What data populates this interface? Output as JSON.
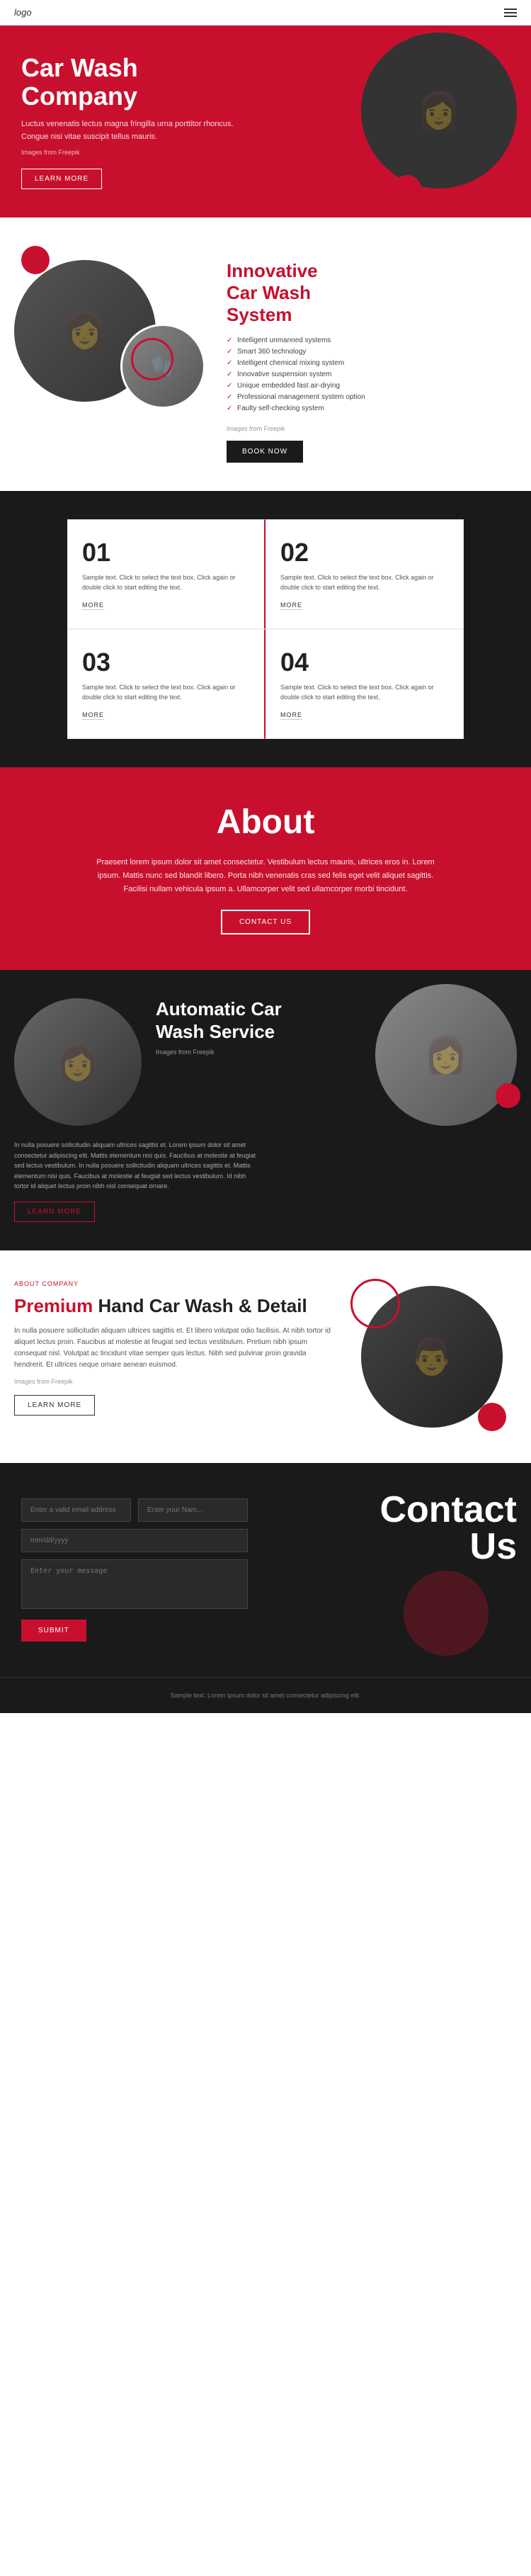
{
  "header": {
    "logo": "logo",
    "menu_icon": "≡"
  },
  "hero": {
    "title_line1": "Car Wash",
    "title_line2": "Company",
    "body": "Luctus venenatis lectus magna fringilla urna porttitor rhoncus. Congue nisi vitae suscipit tellus mauris.",
    "img_credit": "Images from Freepik",
    "learn_more": "LEARN MORE"
  },
  "innovative": {
    "title_part1": "Innovative",
    "title_part2": "Car Wash",
    "title_part3": "System",
    "img_credit": "Images from Freepik",
    "features": [
      "Intelligent unmanned systems",
      "Smart 360 technology",
      "Intelligent chemical mixing system",
      "Innovative suspension system",
      "Unique embedded fast air-drying",
      "Professional management system option",
      "Faulty self-checking system"
    ],
    "book_now": "BOOK NOW"
  },
  "numbers": {
    "items": [
      {
        "number": "01",
        "text": "Sample text. Click to select the text box. Click again or double click to start editing the text.",
        "more": "MORE"
      },
      {
        "number": "02",
        "text": "Sample text. Click to select the text box. Click again or double click to start editing the text.",
        "more": "MORE"
      },
      {
        "number": "03",
        "text": "Sample text. Click to select the text box. Click again or double click to start editing the text.",
        "more": "MORE"
      },
      {
        "number": "04",
        "text": "Sample text. Click to select the text box. Click again or double click to start editing the text.",
        "more": "MORE"
      }
    ]
  },
  "about": {
    "title": "About",
    "body": "Praesent lorem ipsum dolor sit amet consectetur. Vestibulum lectus mauris, ultrices eros in. Lorem ipsum. Mattis nunc sed blandit libero. Porta nibh venenatis cras sed felis eget velit aliquet sagittis. Facilisi nullam vehicula ipsum a. Ullamcorper velit sed ullamcorper morbi tincidunt.",
    "contact_us": "CONTACT US"
  },
  "auto_wash": {
    "title_line1": "Automatic Car",
    "title_line2": "Wash Service",
    "img_credit": "Images from Freepik",
    "body": "In nulla posuere sollicitudin aliquam ultrices sagittis et. Lorem ipsum dolor sit amet consectetur adipiscing elit. Mattis elementum nisi quis. Faucibus at molestie at feugiat sed lectus vestibulum. In nulla posuere sollicitudin aliquam ultrices sagittis et. Mattis elementum nisi quis. Faucibus at molestie at feugiat sed lectus vestibulum. Id nibh tortor id aliquet lectus proin nibh nisl consequat ornare.",
    "learn_more": "LEARN MORE"
  },
  "premium": {
    "tag": "ABOUT COMPANY",
    "title_red": "Premium",
    "title_rest": " Hand Car Wash & Detail",
    "body": "In nulla posuere sollicitudin aliquam ultrices sagittis et. Et libero volutpat odio facilisis. At nibh tortor id aliquet lectus proin. Faucibus at molestie at feugiat sed lectus vestibulum. Pretium nibh ipsum consequat nisl. Volutpat ac tincidunt vitae semper quis lectus. Nibh sed pulvinar proin gravida hendrerit. Et ultrices neque ornare aenean euismod.",
    "img_credit": "Images from Freepik",
    "learn_more": "LEARN MORE"
  },
  "contact": {
    "title_line1": "Contact",
    "title_line2": "Us",
    "email_placeholder": "Enter a valid email address",
    "name_placeholder": "Enter your Nam...",
    "date_placeholder": "mm/dd/yyyy",
    "message_placeholder": "Enter your message",
    "submit": "SUBMIT"
  },
  "footer": {
    "text": "Sample text. Lorem ipsum dolor sit amet consectetur adipiscing elit."
  }
}
